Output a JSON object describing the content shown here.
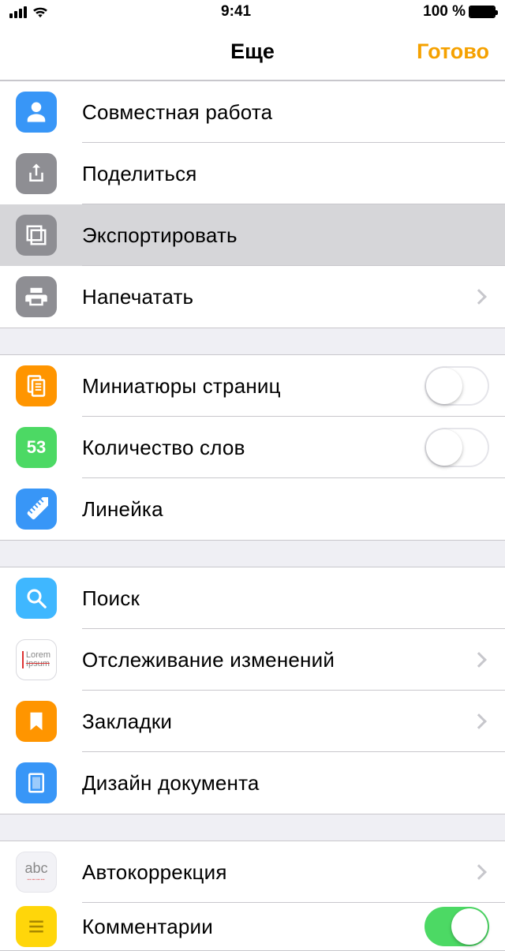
{
  "status": {
    "time": "9:41",
    "battery": "100 %"
  },
  "nav": {
    "title": "Еще",
    "done": "Готово"
  },
  "rows": {
    "collaborate": "Совместная работа",
    "share": "Поделиться",
    "export": "Экспортировать",
    "print": "Напечатать",
    "thumbnails": "Миниатюры страниц",
    "wordcount": "Количество слов",
    "wordcount_value": "53",
    "ruler": "Линейка",
    "search": "Поиск",
    "track": "Отслеживание изменений",
    "bookmarks": "Закладки",
    "design": "Дизайн документа",
    "autocorrect": "Автокоррекция",
    "comments": "Комментарии",
    "autocorrect_glyph": "abc",
    "lorem1": "Lorem",
    "lorem2": "Ipsum"
  },
  "toggles": {
    "thumbnails": false,
    "wordcount": false,
    "comments": true
  }
}
